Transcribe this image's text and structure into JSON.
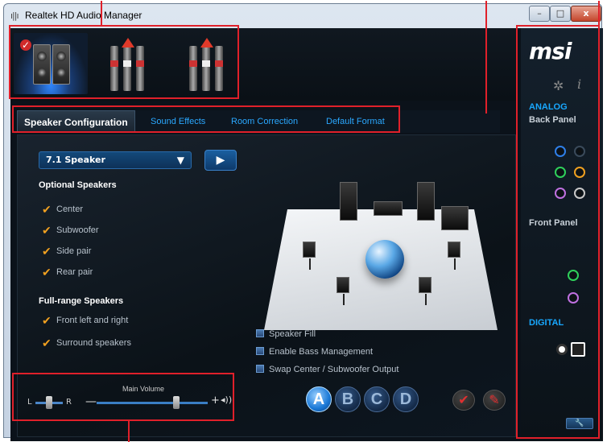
{
  "window": {
    "title": "Realtek HD Audio Manager",
    "min_label": "–",
    "max_label": "□",
    "close_label": "x"
  },
  "tabs": [
    {
      "label": "Speaker Configuration",
      "active": true
    },
    {
      "label": "Sound Effects",
      "active": false
    },
    {
      "label": "Room Correction",
      "active": false
    },
    {
      "label": "Default Format",
      "active": false
    }
  ],
  "speaker_config": {
    "selected": "7.1 Speaker",
    "optional_heading": "Optional Speakers",
    "optional": [
      "Center",
      "Subwoofer",
      "Side pair",
      "Rear pair"
    ],
    "fullrange_heading": "Full-range Speakers",
    "fullrange": [
      "Front left and right",
      "Surround speakers"
    ],
    "extras": [
      "Speaker Fill",
      "Enable Bass Management",
      "Swap Center / Subwoofer Output"
    ]
  },
  "volume": {
    "label": "Main Volume",
    "balance_left": "L",
    "balance_right": "R",
    "minus": "—",
    "plus": "+",
    "level_fraction": 0.72,
    "balance_fraction": 0.5
  },
  "profiles": [
    "A",
    "B",
    "C",
    "D"
  ],
  "active_profile": "A",
  "msi_panel": {
    "logo": "msi",
    "analog_heading": "ANALOG",
    "back_panel_heading": "Back Panel",
    "front_panel_heading": "Front Panel",
    "digital_heading": "DIGITAL",
    "accent": "#18a8ff"
  },
  "jack_colors": {
    "blue": "#2f7fe8",
    "green": "#2fd05a",
    "orange": "#f0a020",
    "pink": "#c070e0",
    "gray": "#c8c8c8"
  }
}
